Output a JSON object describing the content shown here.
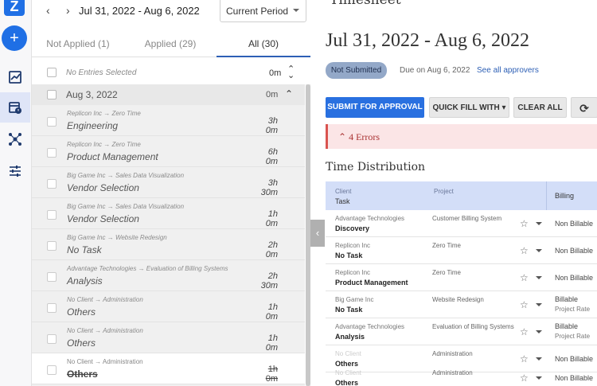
{
  "rail": {
    "logo_letter": "Z",
    "add_symbol": "+",
    "icons": [
      "reports-icon",
      "timesheet-calendar-icon",
      "network-icon",
      "settings-sliders-icon"
    ]
  },
  "date_nav": {
    "range": "Jul 31, 2022 - Aug 6, 2022",
    "prev": "‹",
    "next": "›",
    "period_value": "Current Period"
  },
  "tabs": [
    {
      "label": "Not Applied (1)"
    },
    {
      "label": "Applied (29)"
    },
    {
      "label": "All (30)"
    }
  ],
  "selection": {
    "label": "No Entries Selected",
    "total": "0m"
  },
  "day": {
    "date": "Aug 3, 2022",
    "total": "0m"
  },
  "entries": [
    {
      "client": "Replicon Inc",
      "project": "Zero Time",
      "task": "Engineering",
      "duration": "3h 0m"
    },
    {
      "client": "Replicon Inc",
      "project": "Zero Time",
      "task": "Product Management",
      "duration": "6h 0m"
    },
    {
      "client": "Big Game Inc",
      "project": "Sales Data Visualization",
      "task": "Vendor Selection",
      "duration": "3h 30m"
    },
    {
      "client": "Big Game Inc",
      "project": "Sales Data Visualization",
      "task": "Vendor Selection",
      "duration": "1h 0m"
    },
    {
      "client": "Big Game Inc",
      "project": "Website Redesign",
      "task": "No Task",
      "duration": "2h 0m"
    },
    {
      "client": "Advantage Technologies",
      "project": "Evaluation of Billing Systems",
      "task": "Analysis",
      "duration": "2h 30m"
    },
    {
      "client": "No Client",
      "project": "Administration",
      "task": "Others",
      "duration": "1h 0m"
    },
    {
      "client": "No Client",
      "project": "Administration",
      "task": "Others",
      "duration": "1h 0m"
    },
    {
      "client": "No Client",
      "project": "Administration",
      "task": "Others",
      "duration": "1h 0m"
    }
  ],
  "arrow": "→",
  "timesheet": {
    "title": "Timesheet",
    "range": "Jul 31, 2022 - Aug 6, 2022",
    "status": "Not Submitted",
    "due": "Due on Aug 6, 2022",
    "approvers_link": "See all approvers"
  },
  "actions": {
    "submit": "SUBMIT FOR APPROVAL",
    "quick_fill": "QUICK FILL WITH",
    "clear_all": "CLEAR ALL",
    "refresh": "⟳"
  },
  "errors": {
    "label": "4 Errors"
  },
  "distribution": {
    "title": "Time Distribution",
    "headers": {
      "client": "Client",
      "task": "Task",
      "project": "Project",
      "billing": "Billing"
    },
    "rows": [
      {
        "client": "Advantage Technologies",
        "task": "Discovery",
        "project": "Customer Billing System",
        "billing": "Non Billable",
        "rate": ""
      },
      {
        "client": "Replicon Inc",
        "task": "No Task",
        "project": "Zero Time",
        "billing": "Non Billable",
        "rate": ""
      },
      {
        "client": "Replicon Inc",
        "task": "Product Management",
        "project": "Zero Time",
        "billing": "Non Billable",
        "rate": ""
      },
      {
        "client": "Big Game Inc",
        "task": "No Task",
        "project": "Website Redesign",
        "billing": "Billable",
        "rate": "Project Rate"
      },
      {
        "client": "Advantage Technologies",
        "task": "Analysis",
        "project": "Evaluation of Billing Systems",
        "billing": "Billable",
        "rate": "Project Rate"
      },
      {
        "client": "No Client",
        "task": "Others",
        "project": "Administration",
        "billing": "Non Billable",
        "rate": ""
      },
      {
        "client": "No Client",
        "task": "Others",
        "project": "Administration",
        "billing": "Non Billable",
        "rate": ""
      }
    ]
  },
  "colors": {
    "primary": "#2970e0",
    "error": "#d9534f",
    "table_header": "#d3def8"
  }
}
